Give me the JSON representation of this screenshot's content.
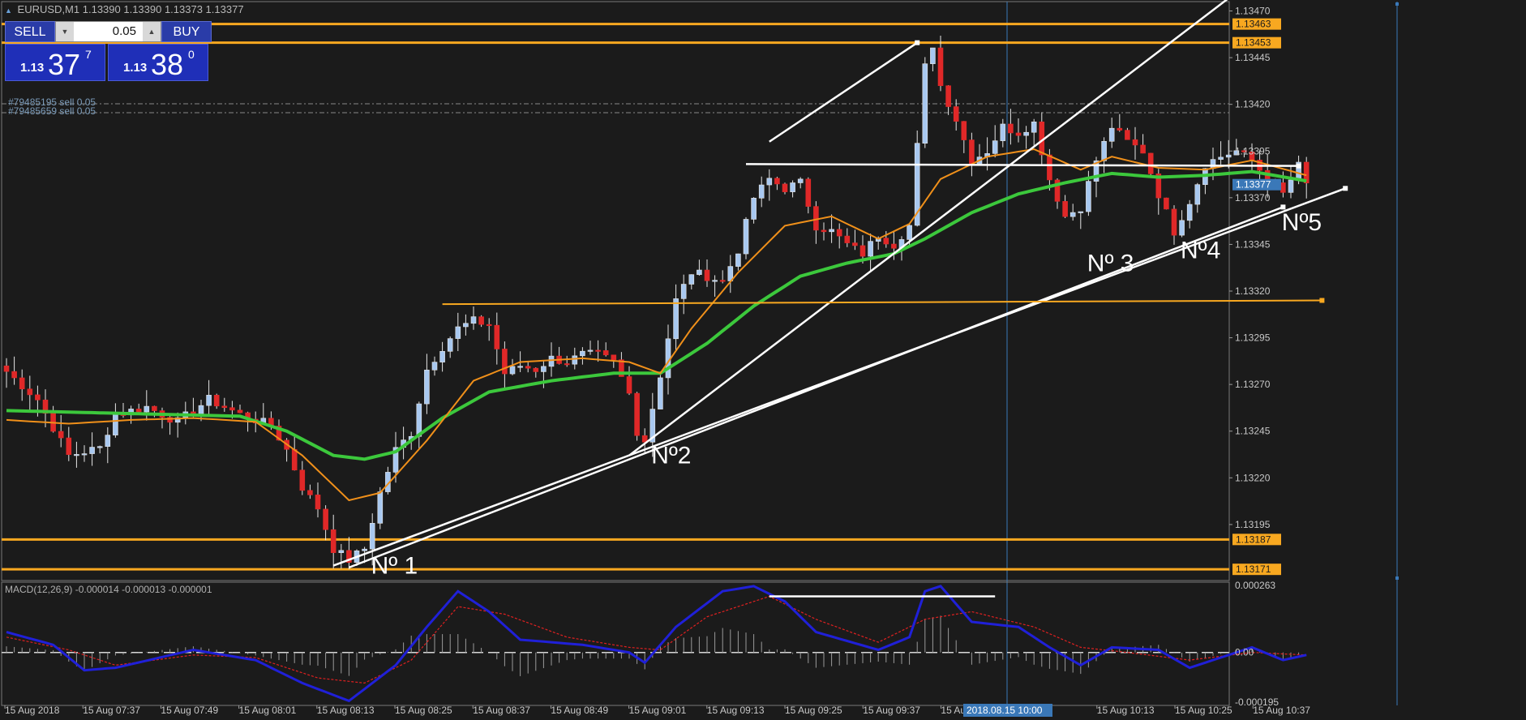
{
  "header": {
    "title": "EURUSD,M1",
    "ohlc": "1.13390 1.13390 1.13373 1.13377"
  },
  "trade_panel": {
    "sell_label": "SELL",
    "buy_label": "BUY",
    "lot_value": "0.05",
    "sell_prefix": "1.13",
    "sell_big": "37",
    "sell_sup": "7",
    "buy_prefix": "1.13",
    "buy_big": "38",
    "buy_sup": "0"
  },
  "orders": [
    "#79485195 sell 0.05",
    "#79485659 sell 0.05"
  ],
  "macd_title": "MACD(12,26,9) -0.000014 -0.000013 -0.000001",
  "colors": {
    "bg": "#1b1b1b",
    "bull": "#a8c8f0",
    "bear": "#e02828",
    "ema_fast": "#f0901a",
    "ema_slow": "#3cc83c",
    "level": "#f8a820",
    "trend": "#ffffff",
    "macd": "#2020d8",
    "signal": "#e02020",
    "vline": "#3a78b8",
    "axis_tag": "#f8a820",
    "price_tag": "#3a78b8"
  },
  "chart_data": [
    {
      "type": "candlestick",
      "symbol": "EURUSD",
      "timeframe": "M1",
      "ylim": [
        1.13165,
        1.13475
      ],
      "y_ticks": [
        "1.13470",
        "1.13445",
        "1.13420",
        "1.13395",
        "1.13370",
        "1.13345",
        "1.13320",
        "1.13295",
        "1.13270",
        "1.13245",
        "1.13220",
        "1.13195"
      ],
      "x_ticks": [
        "15 Aug 2018",
        "15 Aug 07:37",
        "15 Aug 07:49",
        "15 Aug 08:01",
        "15 Aug 08:13",
        "15 Aug 08:25",
        "15 Aug 08:37",
        "15 Aug 08:49",
        "15 Aug 09:01",
        "15 Aug 09:13",
        "15 Aug 09:25",
        "15 Aug 09:37",
        "15 Au",
        "0:01",
        "15 Aug 10:13",
        "15 Aug 10:25",
        "15 Aug 10:37"
      ],
      "cursor_time_label": "2018.08.15 10:00",
      "price_tags": [
        {
          "label": "1.13463",
          "value": 1.13463,
          "kind": "level"
        },
        {
          "label": "1.13453",
          "value": 1.13453,
          "kind": "level"
        },
        {
          "label": "1.13377",
          "value": 1.13377,
          "kind": "current"
        },
        {
          "label": "1.13187",
          "value": 1.13187,
          "kind": "level"
        },
        {
          "label": "1.13171",
          "value": 1.13171,
          "kind": "level"
        }
      ],
      "horizontal_levels": [
        1.13463,
        1.13453,
        1.13187,
        1.13171
      ],
      "grid": false,
      "annotations": [
        {
          "label": "Nº 1",
          "bar": 46,
          "price": 1.13173
        },
        {
          "label": "Nº2",
          "bar": 82,
          "price": 1.13232
        },
        {
          "label": "Nº 3",
          "bar": 138,
          "price": 1.13335
        },
        {
          "label": "Nº4",
          "bar": 150,
          "price": 1.13342
        },
        {
          "label": "Nº5",
          "bar": 163,
          "price": 1.13357
        }
      ],
      "candle_count": 168,
      "waypoints": [
        [
          0,
          1.13277
        ],
        [
          4,
          1.13262
        ],
        [
          8,
          1.13232
        ],
        [
          12,
          1.13236
        ],
        [
          14,
          1.13254
        ],
        [
          18,
          1.13258
        ],
        [
          22,
          1.1325
        ],
        [
          26,
          1.13262
        ],
        [
          30,
          1.13254
        ],
        [
          34,
          1.13248
        ],
        [
          36,
          1.13235
        ],
        [
          38,
          1.13215
        ],
        [
          40,
          1.13204
        ],
        [
          42,
          1.13182
        ],
        [
          44,
          1.13176
        ],
        [
          46,
          1.13182
        ],
        [
          48,
          1.13212
        ],
        [
          50,
          1.13235
        ],
        [
          52,
          1.13244
        ],
        [
          54,
          1.13278
        ],
        [
          56,
          1.1329
        ],
        [
          58,
          1.133
        ],
        [
          60,
          1.13304
        ],
        [
          62,
          1.13302
        ],
        [
          64,
          1.13276
        ],
        [
          66,
          1.1328
        ],
        [
          68,
          1.13278
        ],
        [
          70,
          1.13284
        ],
        [
          72,
          1.13282
        ],
        [
          74,
          1.13286
        ],
        [
          76,
          1.13286
        ],
        [
          78,
          1.13282
        ],
        [
          80,
          1.13265
        ],
        [
          81,
          1.13245
        ],
        [
          82,
          1.1324
        ],
        [
          84,
          1.13275
        ],
        [
          86,
          1.13315
        ],
        [
          88,
          1.1333
        ],
        [
          90,
          1.13328
        ],
        [
          92,
          1.13325
        ],
        [
          94,
          1.13342
        ],
        [
          96,
          1.1337
        ],
        [
          98,
          1.1338
        ],
        [
          100,
          1.13375
        ],
        [
          102,
          1.13378
        ],
        [
          104,
          1.13355
        ],
        [
          106,
          1.13352
        ],
        [
          108,
          1.13345
        ],
        [
          110,
          1.1334
        ],
        [
          112,
          1.1335
        ],
        [
          114,
          1.13345
        ],
        [
          116,
          1.13355
        ],
        [
          118,
          1.1344
        ],
        [
          119,
          1.13452
        ],
        [
          120,
          1.1343
        ],
        [
          122,
          1.13412
        ],
        [
          124,
          1.1339
        ],
        [
          126,
          1.13395
        ],
        [
          128,
          1.13408
        ],
        [
          130,
          1.13405
        ],
        [
          132,
          1.1341
        ],
        [
          134,
          1.1338
        ],
        [
          136,
          1.1336
        ],
        [
          138,
          1.13365
        ],
        [
          140,
          1.1339
        ],
        [
          142,
          1.13408
        ],
        [
          144,
          1.134
        ],
        [
          146,
          1.13395
        ],
        [
          148,
          1.13372
        ],
        [
          150,
          1.13352
        ],
        [
          152,
          1.13368
        ],
        [
          154,
          1.13388
        ],
        [
          156,
          1.13392
        ],
        [
          158,
          1.13395
        ],
        [
          160,
          1.1339
        ],
        [
          162,
          1.1338
        ],
        [
          164,
          1.13372
        ],
        [
          166,
          1.13387
        ],
        [
          167,
          1.13377
        ]
      ],
      "ema_fast_waypoints": [
        [
          0,
          1.13251
        ],
        [
          8,
          1.13249
        ],
        [
          16,
          1.13251
        ],
        [
          24,
          1.13252
        ],
        [
          32,
          1.1325
        ],
        [
          38,
          1.13232
        ],
        [
          44,
          1.13208
        ],
        [
          48,
          1.13212
        ],
        [
          54,
          1.1324
        ],
        [
          60,
          1.13272
        ],
        [
          66,
          1.13282
        ],
        [
          74,
          1.13284
        ],
        [
          80,
          1.13282
        ],
        [
          84,
          1.13276
        ],
        [
          88,
          1.133
        ],
        [
          94,
          1.1333
        ],
        [
          100,
          1.13355
        ],
        [
          106,
          1.1336
        ],
        [
          112,
          1.13348
        ],
        [
          116,
          1.13356
        ],
        [
          120,
          1.1338
        ],
        [
          126,
          1.13392
        ],
        [
          132,
          1.13396
        ],
        [
          138,
          1.13385
        ],
        [
          142,
          1.13392
        ],
        [
          148,
          1.13386
        ],
        [
          154,
          1.13385
        ],
        [
          160,
          1.1339
        ],
        [
          167,
          1.13382
        ]
      ],
      "ema_slow_waypoints": [
        [
          0,
          1.13256
        ],
        [
          10,
          1.13255
        ],
        [
          20,
          1.13254
        ],
        [
          30,
          1.13253
        ],
        [
          36,
          1.13245
        ],
        [
          42,
          1.13232
        ],
        [
          46,
          1.1323
        ],
        [
          50,
          1.13234
        ],
        [
          56,
          1.13252
        ],
        [
          62,
          1.13266
        ],
        [
          70,
          1.13272
        ],
        [
          78,
          1.13276
        ],
        [
          84,
          1.13276
        ],
        [
          90,
          1.13292
        ],
        [
          96,
          1.13312
        ],
        [
          102,
          1.13328
        ],
        [
          108,
          1.13335
        ],
        [
          114,
          1.1334
        ],
        [
          118,
          1.13348
        ],
        [
          124,
          1.13362
        ],
        [
          130,
          1.13372
        ],
        [
          136,
          1.13378
        ],
        [
          142,
          1.13383
        ],
        [
          148,
          1.13381
        ],
        [
          154,
          1.13382
        ],
        [
          160,
          1.13384
        ],
        [
          167,
          1.13379
        ]
      ],
      "trend_lines": [
        [
          [
            42,
            1.13173
          ],
          [
            172,
            1.13375
          ]
        ],
        [
          [
            44,
            1.13172
          ],
          [
            164,
            1.13365
          ]
        ],
        [
          [
            80,
            1.13232
          ],
          [
            158,
            1.1348
          ]
        ],
        [
          [
            98,
            1.134
          ],
          [
            117,
            1.13453
          ]
        ],
        [
          [
            95,
            1.13388
          ],
          [
            166,
            1.13387
          ]
        ],
        [
          [
            56,
            1.13313
          ],
          [
            169,
            1.13315
          ]
        ]
      ]
    },
    {
      "type": "line",
      "title": "MACD(12,26,9)",
      "series": [
        {
          "name": "MACD"
        },
        {
          "name": "Signal"
        },
        {
          "name": "Histogram"
        }
      ],
      "y_ticks": [
        "0.000263",
        "0.00",
        "-0.000195"
      ],
      "ylim": [
        -0.000195,
        0.000263
      ],
      "macd_waypoints": [
        [
          0,
          8e-05
        ],
        [
          6,
          3e-05
        ],
        [
          10,
          -7e-05
        ],
        [
          14,
          -6e-05
        ],
        [
          24,
          1e-05
        ],
        [
          32,
          -3e-05
        ],
        [
          38,
          -0.00012
        ],
        [
          44,
          -0.00019
        ],
        [
          50,
          -5e-05
        ],
        [
          54,
          0.0001
        ],
        [
          58,
          0.00024
        ],
        [
          62,
          0.00016
        ],
        [
          66,
          5e-05
        ],
        [
          74,
          3e-05
        ],
        [
          80,
          0.0
        ],
        [
          82,
          -4e-05
        ],
        [
          86,
          0.0001
        ],
        [
          92,
          0.00024
        ],
        [
          96,
          0.00026
        ],
        [
          100,
          0.0002
        ],
        [
          104,
          8e-05
        ],
        [
          112,
          1e-05
        ],
        [
          116,
          6e-05
        ],
        [
          118,
          0.00024
        ],
        [
          120,
          0.00026
        ],
        [
          124,
          0.00012
        ],
        [
          130,
          0.0001
        ],
        [
          134,
          2e-05
        ],
        [
          138,
          -5e-05
        ],
        [
          142,
          2e-05
        ],
        [
          148,
          1e-05
        ],
        [
          152,
          -6e-05
        ],
        [
          156,
          -2e-05
        ],
        [
          160,
          2e-05
        ],
        [
          164,
          -3e-05
        ],
        [
          167,
          -1e-05
        ]
      ],
      "signal_waypoints": [
        [
          0,
          6e-05
        ],
        [
          8,
          1e-05
        ],
        [
          14,
          -5e-05
        ],
        [
          24,
          -1e-05
        ],
        [
          32,
          -2e-05
        ],
        [
          40,
          -0.0001
        ],
        [
          46,
          -0.00012
        ],
        [
          52,
          -3e-05
        ],
        [
          58,
          0.00018
        ],
        [
          64,
          0.00015
        ],
        [
          72,
          6e-05
        ],
        [
          80,
          2e-05
        ],
        [
          84,
          1e-05
        ],
        [
          90,
          0.00014
        ],
        [
          98,
          0.00022
        ],
        [
          104,
          0.00013
        ],
        [
          112,
          4e-05
        ],
        [
          118,
          0.00013
        ],
        [
          124,
          0.00016
        ],
        [
          132,
          0.0001
        ],
        [
          138,
          2e-05
        ],
        [
          144,
          0.0
        ],
        [
          152,
          -3e-05
        ],
        [
          160,
          0.0
        ],
        [
          167,
          -1e-05
        ]
      ],
      "trend_line": [
        [
          98,
          0.00022
        ],
        [
          127,
          0.00022
        ]
      ]
    }
  ]
}
